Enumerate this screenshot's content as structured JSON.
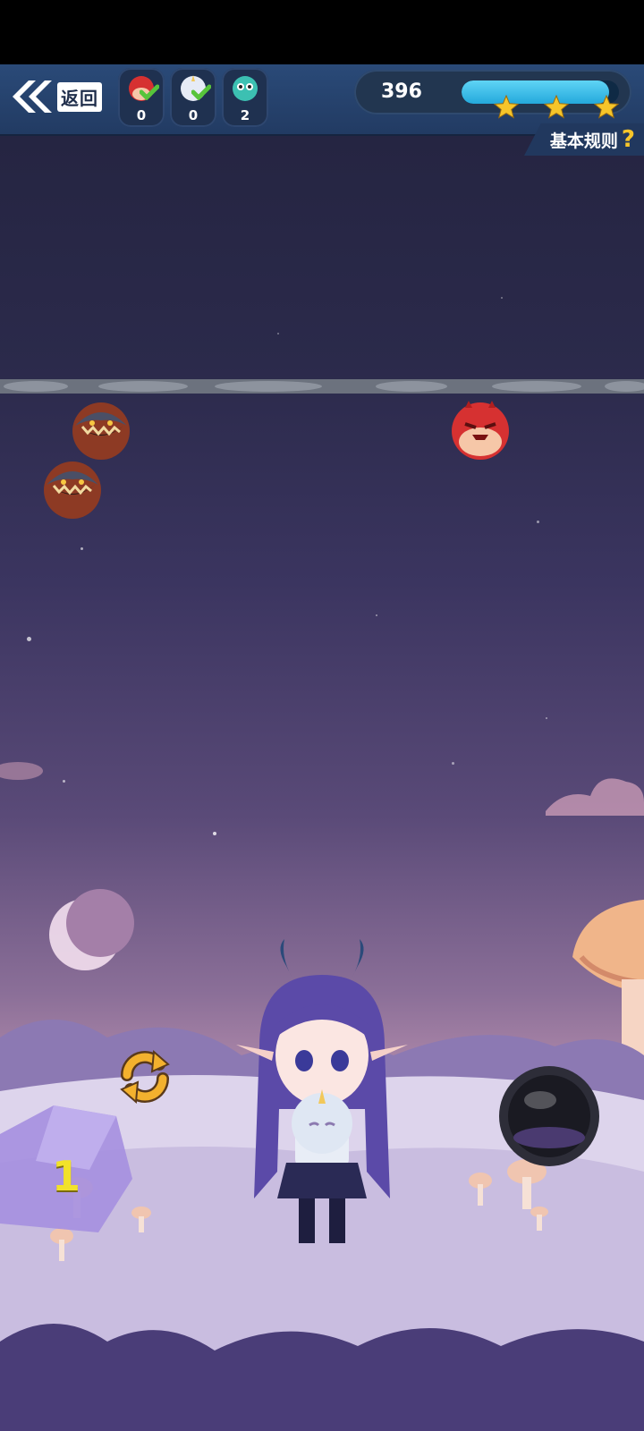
{
  "header": {
    "back_label": "返回",
    "monster_counts": [
      "0",
      "0",
      "2"
    ],
    "score": "396",
    "progress_fraction": 0.94,
    "rules_label": "基本规则",
    "rules_mark": "?"
  },
  "game": {
    "ammo_count": "1"
  },
  "icons": {
    "back": "double-chevron-left-icon",
    "monster_1": "red-dragon-icon",
    "monster_2": "white-unicorn-icon",
    "monster_3": "teal-bird-icon",
    "swap": "swap-arrows-icon",
    "shoot": "black-orb-button"
  },
  "colors": {
    "header_bg": "#2a4a78",
    "progress_fill": "#24a9dc",
    "star": "#f6c52a",
    "ammo_number": "#f2e22a"
  }
}
